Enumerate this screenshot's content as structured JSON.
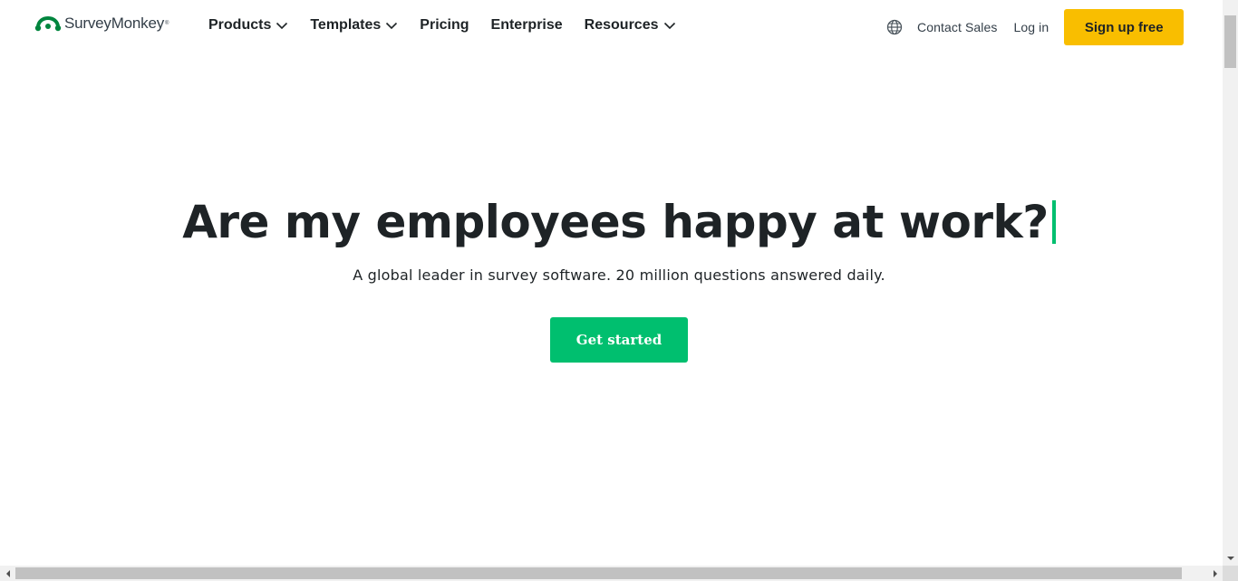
{
  "brand": {
    "name": "SurveyMonkey",
    "trademark": "®",
    "logo_color": "#00bf6f"
  },
  "nav": {
    "items": [
      {
        "label": "Products",
        "has_dropdown": true
      },
      {
        "label": "Templates",
        "has_dropdown": true
      },
      {
        "label": "Pricing",
        "has_dropdown": false
      },
      {
        "label": "Enterprise",
        "has_dropdown": false
      },
      {
        "label": "Resources",
        "has_dropdown": true
      }
    ]
  },
  "right_nav": {
    "language_icon": "globe-icon",
    "contact_sales": "Contact Sales",
    "log_in": "Log in",
    "sign_up": "Sign up free",
    "sign_up_color": "#f9be00"
  },
  "hero": {
    "title": "Are my employees happy at work?",
    "subtitle": "A global leader in survey software. 20 million questions answered daily.",
    "cta": "Get started",
    "cta_color": "#00bf6f",
    "caret_color": "#00bf6f"
  }
}
